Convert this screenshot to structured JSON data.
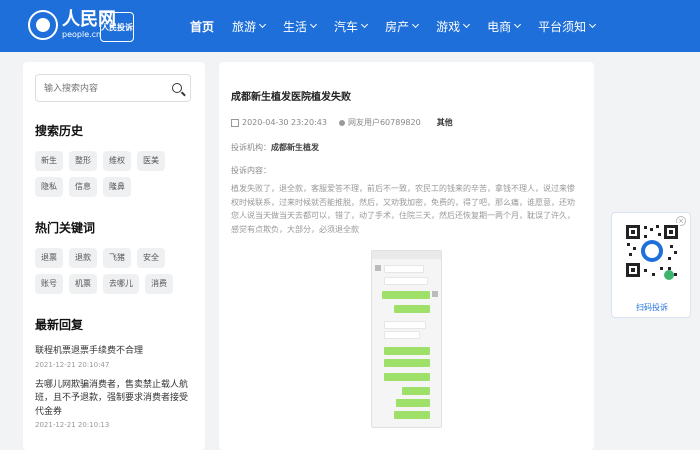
{
  "header": {
    "logo_cn": "人民网",
    "logo_en": "people.cn",
    "badge": "人民投诉",
    "nav": [
      {
        "label": "首页",
        "active": true,
        "has_caret": false
      },
      {
        "label": "旅游",
        "active": false,
        "has_caret": true
      },
      {
        "label": "生活",
        "active": false,
        "has_caret": true
      },
      {
        "label": "汽车",
        "active": false,
        "has_caret": true
      },
      {
        "label": "房产",
        "active": false,
        "has_caret": true
      },
      {
        "label": "游戏",
        "active": false,
        "has_caret": true
      },
      {
        "label": "电商",
        "active": false,
        "has_caret": true
      },
      {
        "label": "平台须知",
        "active": false,
        "has_caret": true
      }
    ]
  },
  "sidebar": {
    "search_placeholder": "输入搜索内容",
    "history_title": "搜索历史",
    "history_tags": [
      "新生",
      "整形",
      "维权",
      "医美",
      "隐私",
      "信息",
      "隆鼻"
    ],
    "hot_title": "热门关键词",
    "hot_tags": [
      "退票",
      "退款",
      "飞猪",
      "安全",
      "账号",
      "机票",
      "去哪儿",
      "消费"
    ],
    "recent_title": "最新回复",
    "recent": [
      {
        "title": "联程机票退票手续费不合理",
        "time": "2021-12-21 20:10:47"
      },
      {
        "title": "去哪儿网欺骗消费者，售卖禁止载人航班，且不予退款，强制要求消费者接受代金券",
        "time": "2021-12-21 20:10:13"
      }
    ]
  },
  "article": {
    "title": "成都新生植发医院植发失败",
    "date": "2020-04-30 23:20:43",
    "user": "网友用户60789820",
    "category": "其他",
    "org_label": "投诉机构：",
    "org_name": "成都新生植发",
    "content_label": "投诉内容：",
    "content": "植发失败了，退全款，客服爱答不理，前后不一致，农民工的钱来的辛苦，拿钱不理人，说过来惨权时候联系，过来时候就否能推脱，然后，又劝我加密，免费的，得了吧，那么痛，谁愿意，还劝您人说当天做当天去都可以，错了，动了手术，住院三天，然后还恢复期一两个月，耽误了许久，感觉有点欺负，大部分，必须退全款"
  },
  "qr": {
    "label": "扫码投诉"
  },
  "colors": {
    "brand": "#1e6fd9",
    "page_bg": "#f2f3f5"
  }
}
